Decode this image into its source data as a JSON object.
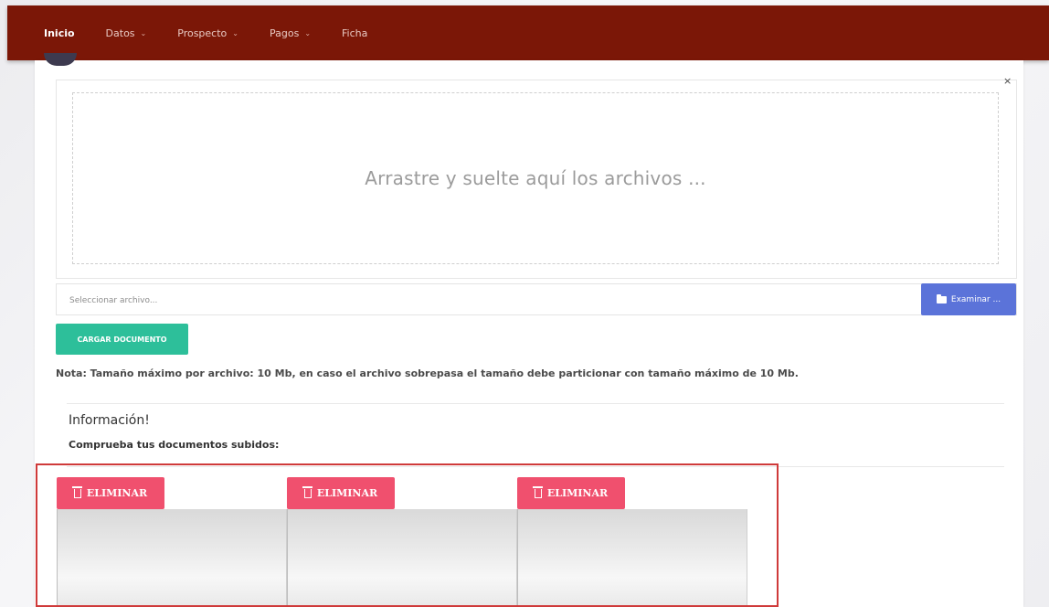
{
  "nav": {
    "items": [
      {
        "label": "Inicio",
        "active": true,
        "dropdown": false
      },
      {
        "label": "Datos",
        "active": false,
        "dropdown": true
      },
      {
        "label": "Prospecto",
        "active": false,
        "dropdown": true
      },
      {
        "label": "Pagos",
        "active": false,
        "dropdown": true
      },
      {
        "label": "Ficha",
        "active": false,
        "dropdown": false
      }
    ]
  },
  "dropzone": {
    "close_label": "×",
    "text": "Arrastre y suelte aquí los archivos ..."
  },
  "file_input": {
    "placeholder": "Seleccionar archivo...",
    "browse_label": "Examinar ..."
  },
  "upload_button": "CARGAR DOCUMENTO",
  "note": "Nota: Tamaño máximo por archivo: 10 Mb, en caso el archivo sobrepasa el tamaño debe particionar con tamaño máximo de 10 Mb.",
  "info": {
    "title": "Información!",
    "subtitle": "Comprueba tus documentos subidos:"
  },
  "documents": [
    {
      "delete_label": "ELIMINAR"
    },
    {
      "delete_label": "ELIMINAR"
    },
    {
      "delete_label": "ELIMINAR"
    }
  ],
  "colors": {
    "topbar": "#7b1707",
    "browse": "#5b73d9",
    "upload": "#2dbf9a",
    "delete": "#f0506e",
    "highlight": "#cf3a3a"
  }
}
